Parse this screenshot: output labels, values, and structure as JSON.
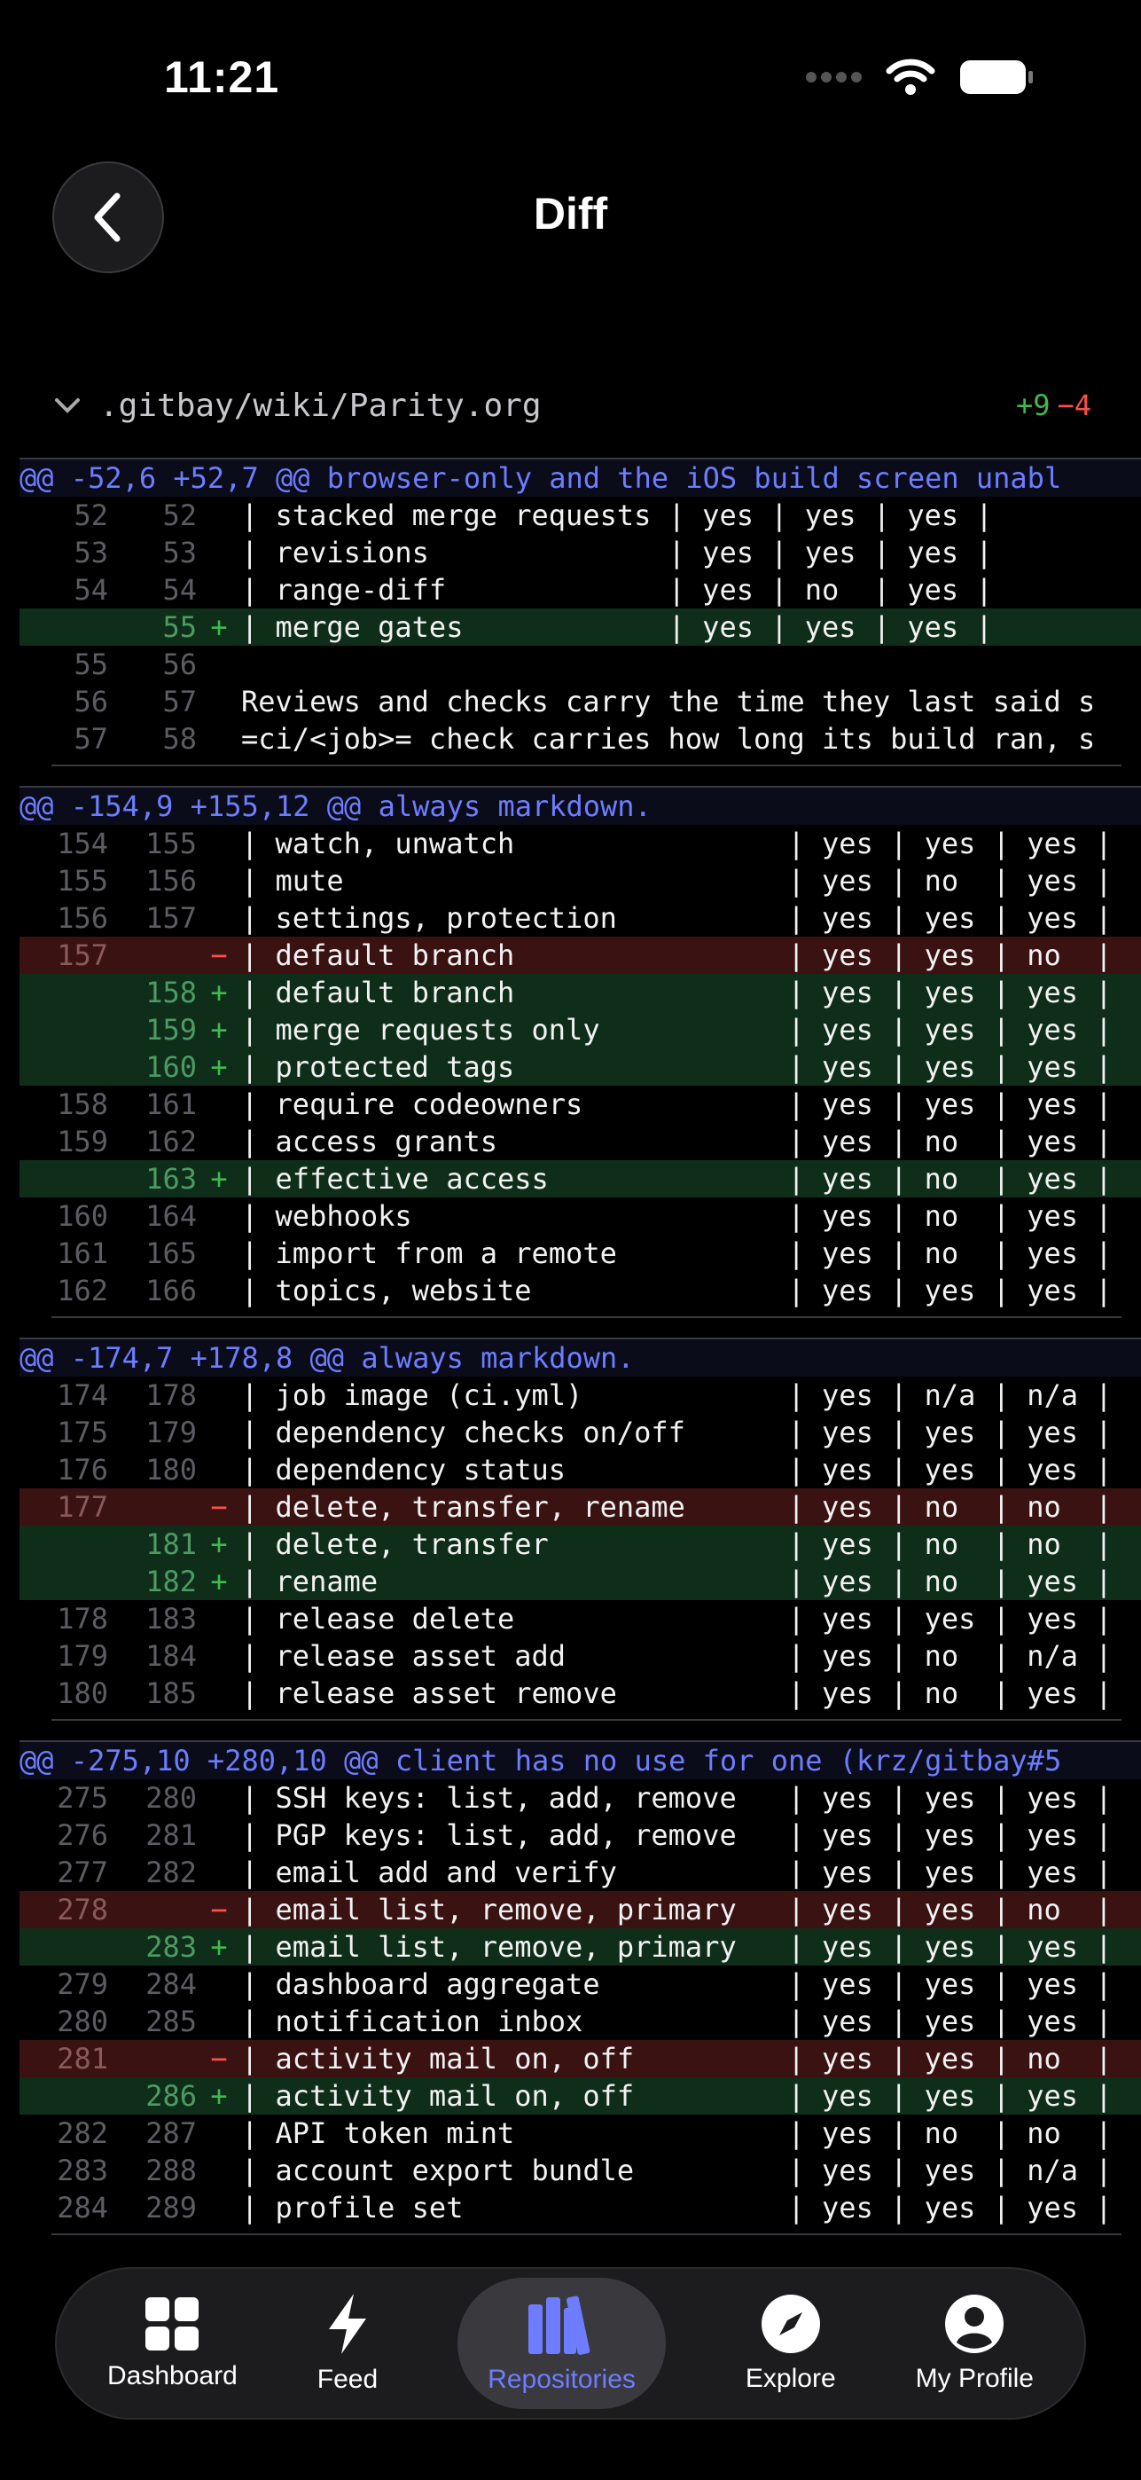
{
  "status": {
    "time": "11:21"
  },
  "header": {
    "title": "Diff"
  },
  "file": {
    "path": ".gitbay/wiki/Parity.org",
    "additions": "+9",
    "deletions": "−4"
  },
  "hunks": [
    {
      "header": "@@ -52,6 +52,7 @@ browser-only and the iOS build screen unabl",
      "lines": [
        {
          "type": "ctx",
          "old": "52",
          "new": "52",
          "code": "| stacked merge requests | yes | yes | yes |"
        },
        {
          "type": "ctx",
          "old": "53",
          "new": "53",
          "code": "| revisions              | yes | yes | yes |"
        },
        {
          "type": "ctx",
          "old": "54",
          "new": "54",
          "code": "| range-diff             | yes | no  | yes |"
        },
        {
          "type": "add",
          "old": "",
          "new": "55",
          "code": "| merge gates            | yes | yes | yes |"
        },
        {
          "type": "ctx",
          "old": "55",
          "new": "56",
          "code": ""
        },
        {
          "type": "ctx",
          "old": "56",
          "new": "57",
          "code": "Reviews and checks carry the time they last said s"
        },
        {
          "type": "ctx",
          "old": "57",
          "new": "58",
          "code": "=ci/<job>= check carries how long its build ran, s"
        }
      ]
    },
    {
      "header": "@@ -154,9 +155,12 @@ always markdown.",
      "lines": [
        {
          "type": "ctx",
          "old": "154",
          "new": "155",
          "code": "| watch, unwatch                | yes | yes | yes |"
        },
        {
          "type": "ctx",
          "old": "155",
          "new": "156",
          "code": "| mute                          | yes | no  | yes |"
        },
        {
          "type": "ctx",
          "old": "156",
          "new": "157",
          "code": "| settings, protection          | yes | yes | yes |"
        },
        {
          "type": "del",
          "old": "157",
          "new": "",
          "code": "| default branch                | yes | yes | no  |"
        },
        {
          "type": "add",
          "old": "",
          "new": "158",
          "code": "| default branch                | yes | yes | yes |"
        },
        {
          "type": "add",
          "old": "",
          "new": "159",
          "code": "| merge requests only           | yes | yes | yes |"
        },
        {
          "type": "add",
          "old": "",
          "new": "160",
          "code": "| protected tags                | yes | yes | yes |"
        },
        {
          "type": "ctx",
          "old": "158",
          "new": "161",
          "code": "| require codeowners            | yes | yes | yes |"
        },
        {
          "type": "ctx",
          "old": "159",
          "new": "162",
          "code": "| access grants                 | yes | no  | yes |"
        },
        {
          "type": "add",
          "old": "",
          "new": "163",
          "code": "| effective access              | yes | no  | yes |"
        },
        {
          "type": "ctx",
          "old": "160",
          "new": "164",
          "code": "| webhooks                      | yes | no  | yes |"
        },
        {
          "type": "ctx",
          "old": "161",
          "new": "165",
          "code": "| import from a remote          | yes | no  | yes |"
        },
        {
          "type": "ctx",
          "old": "162",
          "new": "166",
          "code": "| topics, website               | yes | yes | yes |"
        }
      ]
    },
    {
      "header": "@@ -174,7 +178,8 @@ always markdown.",
      "lines": [
        {
          "type": "ctx",
          "old": "174",
          "new": "178",
          "code": "| job image (ci.yml)            | yes | n/a | n/a |"
        },
        {
          "type": "ctx",
          "old": "175",
          "new": "179",
          "code": "| dependency checks on/off      | yes | yes | yes |"
        },
        {
          "type": "ctx",
          "old": "176",
          "new": "180",
          "code": "| dependency status             | yes | yes | yes |"
        },
        {
          "type": "del",
          "old": "177",
          "new": "",
          "code": "| delete, transfer, rename      | yes | no  | no  |"
        },
        {
          "type": "add",
          "old": "",
          "new": "181",
          "code": "| delete, transfer              | yes | no  | no  |"
        },
        {
          "type": "add",
          "old": "",
          "new": "182",
          "code": "| rename                        | yes | no  | yes |"
        },
        {
          "type": "ctx",
          "old": "178",
          "new": "183",
          "code": "| release delete                | yes | yes | yes |"
        },
        {
          "type": "ctx",
          "old": "179",
          "new": "184",
          "code": "| release asset add             | yes | no  | n/a |"
        },
        {
          "type": "ctx",
          "old": "180",
          "new": "185",
          "code": "| release asset remove          | yes | no  | yes |"
        }
      ]
    },
    {
      "header": "@@ -275,10 +280,10 @@ client has no use for one (krz/gitbay#5",
      "lines": [
        {
          "type": "ctx",
          "old": "275",
          "new": "280",
          "code": "| SSH keys: list, add, remove   | yes | yes | yes |"
        },
        {
          "type": "ctx",
          "old": "276",
          "new": "281",
          "code": "| PGP keys: list, add, remove   | yes | yes | yes |"
        },
        {
          "type": "ctx",
          "old": "277",
          "new": "282",
          "code": "| email add and verify          | yes | yes | yes |"
        },
        {
          "type": "del",
          "old": "278",
          "new": "",
          "code": "| email list, remove, primary   | yes | yes | no  |"
        },
        {
          "type": "add",
          "old": "",
          "new": "283",
          "code": "| email list, remove, primary   | yes | yes | yes |"
        },
        {
          "type": "ctx",
          "old": "279",
          "new": "284",
          "code": "| dashboard aggregate           | yes | yes | yes |"
        },
        {
          "type": "ctx",
          "old": "280",
          "new": "285",
          "code": "| notification inbox            | yes | yes | yes |"
        },
        {
          "type": "del",
          "old": "281",
          "new": "",
          "code": "| activity mail on, off         | yes | yes | no  |"
        },
        {
          "type": "add",
          "old": "",
          "new": "286",
          "code": "| activity mail on, off         | yes | yes | yes |"
        },
        {
          "type": "ctx",
          "old": "282",
          "new": "287",
          "code": "| API token mint                | yes | no  | no  |"
        },
        {
          "type": "ctx",
          "old": "283",
          "new": "288",
          "code": "| account export bundle         | yes | yes | n/a |"
        },
        {
          "type": "ctx",
          "old": "284",
          "new": "289",
          "code": "| profile set                   | yes | yes | yes |"
        }
      ]
    }
  ],
  "tabs": [
    {
      "label": "Dashboard",
      "icon": "grid-icon",
      "active": false
    },
    {
      "label": "Feed",
      "icon": "bolt-icon",
      "active": false
    },
    {
      "label": "Repositories",
      "icon": "books-icon",
      "active": true
    },
    {
      "label": "Explore",
      "icon": "compass-icon",
      "active": false
    },
    {
      "label": "My Profile",
      "icon": "person-icon",
      "active": false
    }
  ],
  "colors": {
    "accent": "#6e7dff",
    "added": "#3fb950",
    "removed": "#f85149"
  }
}
